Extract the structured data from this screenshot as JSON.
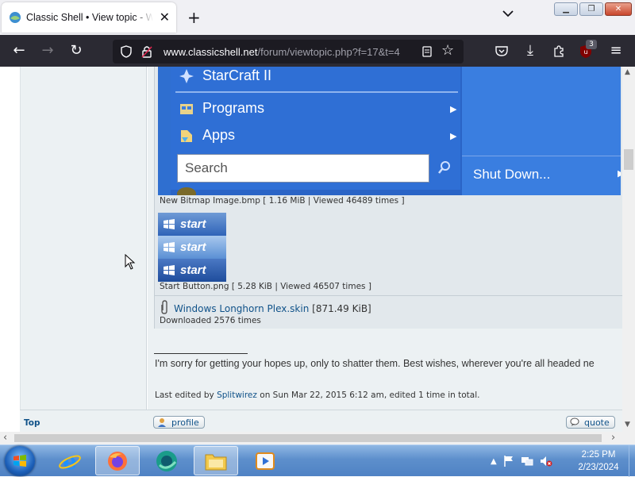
{
  "browser": {
    "tab_title": "Classic Shell • View topic - Windows Longhorn Plex",
    "url_host": "www.classicshell.net",
    "url_path": "/forum/viewtopic.php?f=17&t=4",
    "extensions_badge": "3"
  },
  "start_menu_image": {
    "items": [
      "StarCraft II",
      "Programs",
      "Apps"
    ],
    "search_placeholder": "Search",
    "shutdown_label": "Shut Down..."
  },
  "attachments": [
    {
      "caption": "New Bitmap Image.bmp [ 1.16 MiB | Viewed 46489 times ]"
    },
    {
      "caption": "Start Button.png [ 5.28 KiB | Viewed 46507 times ]",
      "button_rows": [
        "start",
        "start",
        "start"
      ]
    }
  ],
  "file": {
    "name": "Windows Longhorn Plex.skin",
    "size": "[871.49 KiB]",
    "downloads": "Downloaded 2576 times"
  },
  "post": {
    "signature": "I'm sorry for getting your hopes up, only to shatter them. Best wishes, wherever you're all headed ne",
    "edited_prefix": "Last edited by",
    "edited_user": "Splitwirez",
    "edited_suffix": "on Sun Mar 22, 2015 6:12 am, edited 1 time in total."
  },
  "footer": {
    "top_link": "Top",
    "profile_label": "profile",
    "quote_label": "quote"
  },
  "taskbar": {
    "time": "2:25 PM",
    "date": "2/23/2024"
  },
  "colors": {
    "link": "#105289",
    "forum_bg": "#ecf1f3",
    "startmenu_blue": "#2f6fd5",
    "browser_dark": "#2b2a33"
  }
}
